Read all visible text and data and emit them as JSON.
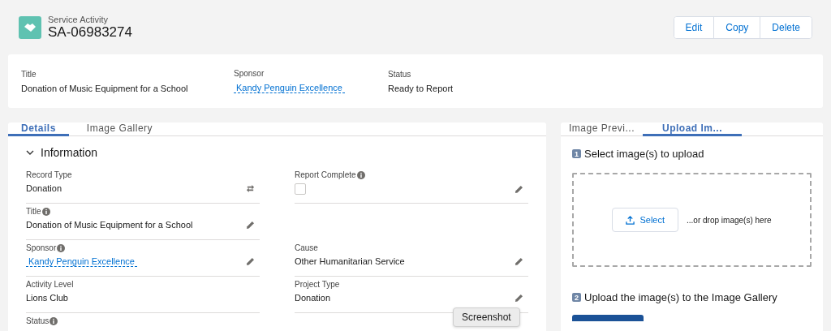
{
  "header": {
    "object_type": "Service Activity",
    "record_name": "SA-06983274",
    "actions": [
      "Edit",
      "Copy",
      "Delete"
    ]
  },
  "highlights": [
    {
      "label": "Title",
      "value": "Donation of Music Equipment for a School",
      "kind": "text"
    },
    {
      "label": "Sponsor",
      "value": "Kandy Penguin Excellence",
      "kind": "link"
    },
    {
      "label": "Status",
      "value": "Ready to Report",
      "kind": "text"
    }
  ],
  "left_tabs": [
    {
      "label": "Details",
      "selected": true
    },
    {
      "label": "Image Gallery",
      "selected": false
    }
  ],
  "section": {
    "title": "Information",
    "expanded": true
  },
  "rows": [
    {
      "left": {
        "label": "Record Type",
        "info": false,
        "kind": "text",
        "value": "Donation",
        "edit": false,
        "change_type": true
      },
      "right": {
        "label": "Report Complete",
        "info": true,
        "kind": "checkbox",
        "checked": false,
        "edit": true,
        "change_type": false
      }
    },
    {
      "left": {
        "label": "Title",
        "info": true,
        "kind": "text",
        "value": "Donation of Music Equipment for a School",
        "edit": true,
        "change_type": false
      },
      "right": null
    },
    {
      "left": {
        "label": "Sponsor",
        "info": true,
        "kind": "link",
        "value": "Kandy Penguin Excellence",
        "edit": true,
        "change_type": false
      },
      "right": {
        "label": "Cause",
        "info": false,
        "kind": "text",
        "value": "Other Humanitarian Service",
        "edit": true,
        "change_type": false
      }
    },
    {
      "left": {
        "label": "Activity Level",
        "info": false,
        "kind": "text",
        "value": "Lions Club",
        "edit": false,
        "change_type": false
      },
      "right": {
        "label": "Project Type",
        "info": false,
        "kind": "text",
        "value": "Donation",
        "edit": true,
        "change_type": false
      }
    },
    {
      "left": {
        "label": "Status",
        "info": true,
        "kind": "label_only"
      },
      "right": null
    }
  ],
  "right_tabs": [
    {
      "label": "Image Previ...",
      "selected": false
    },
    {
      "label": "Upload Im...",
      "selected": true
    }
  ],
  "upload": {
    "steps": [
      {
        "number": "1",
        "text": "Select image(s) to upload"
      },
      {
        "number": "2",
        "text": "Upload the image(s) to the Image Gallery"
      }
    ],
    "select_button": "Select",
    "drop_hint": "...or drop image(s) here"
  },
  "tooltip": "Screenshot"
}
